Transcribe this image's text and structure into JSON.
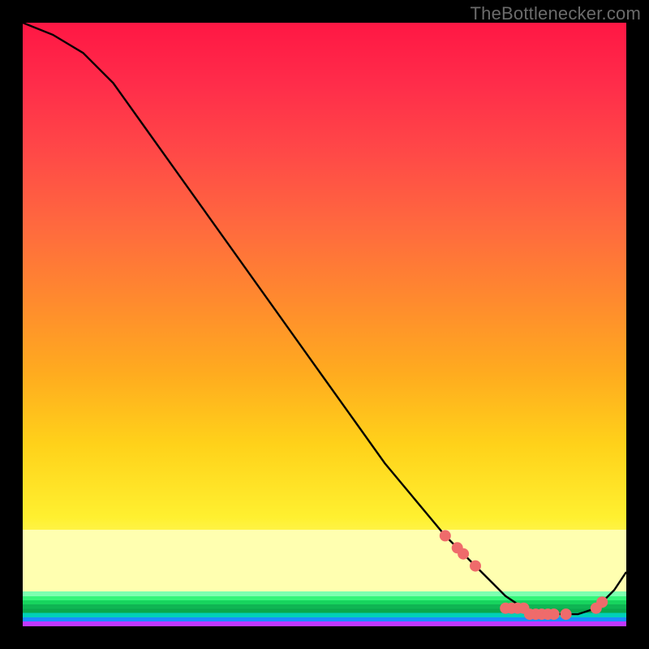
{
  "attribution": "TheBottlenecker.com",
  "chart_data": {
    "type": "line",
    "title": "",
    "xlabel": "",
    "ylabel": "",
    "xlim": [
      0,
      100
    ],
    "ylim": [
      0,
      100
    ],
    "series": [
      {
        "name": "bottleneck-curve",
        "x": [
          0,
          5,
          10,
          15,
          20,
          25,
          30,
          35,
          40,
          45,
          50,
          55,
          60,
          65,
          70,
          72,
          75,
          78,
          80,
          83,
          86,
          88,
          90,
          92,
          95,
          98,
          100
        ],
        "y": [
          100,
          98,
          95,
          90,
          83,
          76,
          69,
          62,
          55,
          48,
          41,
          34,
          27,
          21,
          15,
          13,
          10,
          7,
          5,
          3,
          2,
          2,
          2,
          2,
          3,
          6,
          9
        ]
      }
    ],
    "markers": {
      "name": "highlight-points",
      "color": "#ef6b6b",
      "points": [
        {
          "x": 70,
          "y": 15
        },
        {
          "x": 72,
          "y": 13
        },
        {
          "x": 73,
          "y": 12
        },
        {
          "x": 75,
          "y": 10
        },
        {
          "x": 80,
          "y": 3
        },
        {
          "x": 81,
          "y": 3
        },
        {
          "x": 82,
          "y": 3
        },
        {
          "x": 83,
          "y": 3
        },
        {
          "x": 84,
          "y": 2
        },
        {
          "x": 85,
          "y": 2
        },
        {
          "x": 86,
          "y": 2
        },
        {
          "x": 87,
          "y": 2
        },
        {
          "x": 88,
          "y": 2
        },
        {
          "x": 90,
          "y": 2
        },
        {
          "x": 95,
          "y": 3
        },
        {
          "x": 96,
          "y": 4
        }
      ]
    }
  }
}
